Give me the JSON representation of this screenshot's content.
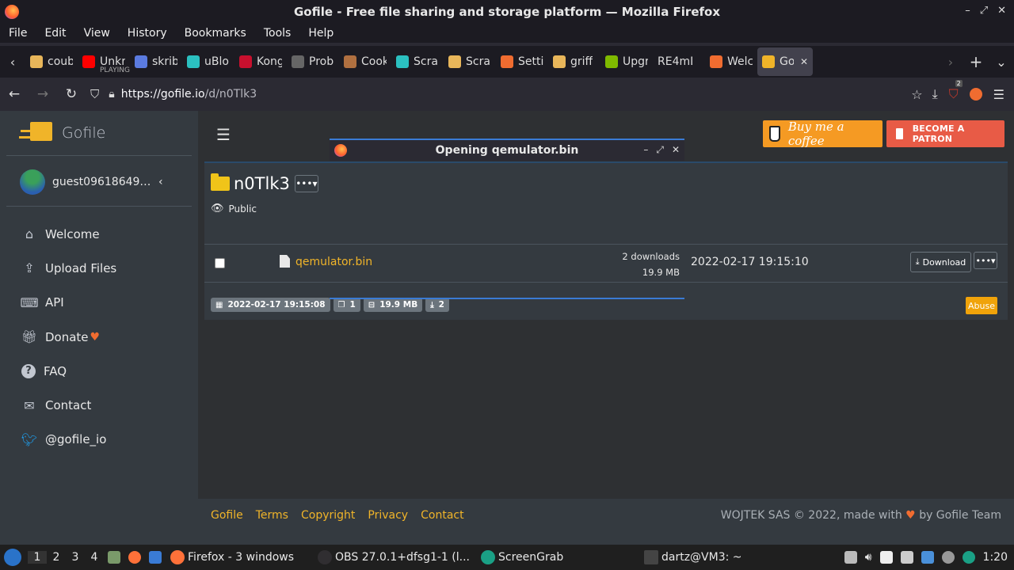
{
  "window": {
    "title": "Gofile - Free file sharing and storage platform — Mozilla Firefox"
  },
  "menu": [
    "File",
    "Edit",
    "View",
    "History",
    "Bookmarks",
    "Tools",
    "Help"
  ],
  "tabs": [
    {
      "label": "coub",
      "icon": "coub-icon",
      "color": "#e8b65a"
    },
    {
      "label": "Unkr",
      "sub": "PLAYING",
      "icon": "youtube-icon",
      "color": "#ff0000"
    },
    {
      "label": "skrib",
      "icon": "skribbl-icon",
      "color": "#5b7be0"
    },
    {
      "label": "uBlo",
      "icon": "ublock-icon",
      "color": "#2bc0c0"
    },
    {
      "label": "Kong",
      "icon": "kongregate-icon",
      "color": "#c8102e"
    },
    {
      "label": "Prob",
      "icon": "info-icon",
      "color": "#666666"
    },
    {
      "label": "Cook",
      "icon": "cookie-icon",
      "color": "#b07040"
    },
    {
      "label": "Scra",
      "icon": "scratch-icon",
      "color": "#2bc0c0"
    },
    {
      "label": "Scra",
      "icon": "scratch-icon",
      "color": "#e8b65a"
    },
    {
      "label": "Setti",
      "icon": "settings-icon",
      "color": "#f06c30"
    },
    {
      "label": "griff",
      "icon": "griffin-icon",
      "color": "#e8b65a"
    },
    {
      "label": "Upgr",
      "icon": "microsoft-icon",
      "color": "#7fba00"
    },
    {
      "label": "RE4mD",
      "icon": "",
      "color": ""
    },
    {
      "label": "Welc",
      "icon": "welcome-icon",
      "color": "#f06c30"
    },
    {
      "label": "Go",
      "icon": "gofile-icon",
      "color": "#f0b429",
      "active": true
    }
  ],
  "nav": {
    "url_host": "https://gofile.io",
    "url_path": "/d/n0Tlk3",
    "extension_badge": "2"
  },
  "sidebar": {
    "brand": "Gofile",
    "username": "guest096186499...",
    "items": [
      {
        "label": "Welcome",
        "icon": "home-icon"
      },
      {
        "label": "Upload Files",
        "icon": "upload-file-icon"
      },
      {
        "label": "API",
        "icon": "laptop-code-icon"
      },
      {
        "label": "Donate",
        "icon": "gift-icon"
      },
      {
        "label": "FAQ",
        "icon": "question-circle-icon"
      },
      {
        "label": "Contact",
        "icon": "envelope-icon"
      },
      {
        "label": "@gofile_io",
        "icon": "twitter-icon"
      }
    ]
  },
  "header": {
    "bmac_label": "Buy me a coffee",
    "patron_label": "BECOME A PATRON"
  },
  "folder": {
    "name": "n0Tlk3",
    "menu": "•••",
    "visibility": "Public"
  },
  "file": {
    "name": "qemulator.bin",
    "downloads": "2 downloads",
    "size": "19.9 MB",
    "date": "2022-02-17 19:15:10",
    "download_label": "Download",
    "more": "•••"
  },
  "stats": {
    "created": "2022-02-17 19:15:08",
    "files": "1",
    "size": "19.9 MB",
    "downloads": "2",
    "abuse_label": "Abuse"
  },
  "footer": {
    "links": [
      "Gofile",
      "Terms",
      "Copyright",
      "Privacy",
      "Contact"
    ],
    "copy_left": "WOJTEK SAS © 2022, made with",
    "copy_right": "by Gofile Team"
  },
  "dialog": {
    "title": "Opening qemulator.bin"
  },
  "taskbar": {
    "workspaces": [
      "1",
      "2",
      "3",
      "4"
    ],
    "tasks": [
      {
        "label": "Firefox - 3 windows",
        "icon": "firefox-icon",
        "color": "#ff7139"
      },
      {
        "label": "OBS 27.0.1+dfsg1-1 (l...",
        "icon": "obs-icon",
        "color": "#302e31"
      },
      {
        "label": "ScreenGrab",
        "icon": "screengrab-icon",
        "color": "#1aa085"
      },
      {
        "label": "dartz@VM3: ~",
        "icon": "terminal-icon",
        "color": "#444444"
      }
    ],
    "clock": "1:20"
  }
}
